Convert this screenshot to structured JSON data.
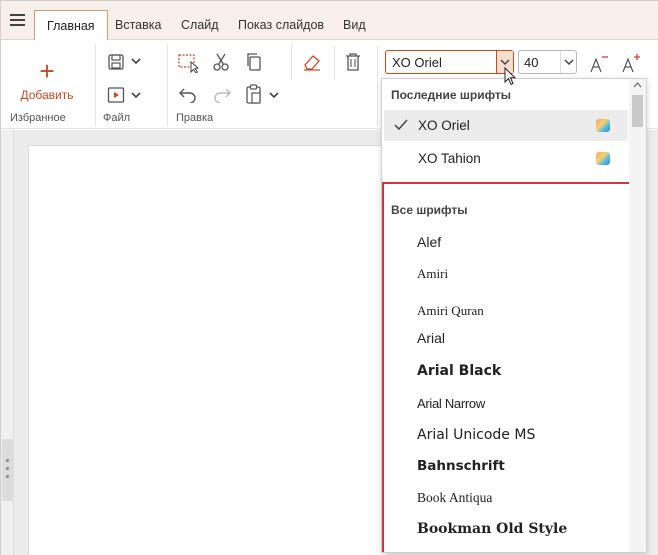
{
  "tabs": [
    "Главная",
    "Вставка",
    "Слайд",
    "Показ слайдов",
    "Вид"
  ],
  "ribbon": {
    "add_label": "Добавить",
    "groups": {
      "favorites": "Избранное",
      "file": "Файл",
      "edit": "Правка"
    },
    "font_name": "XO Oriel",
    "font_size": "40"
  },
  "dropdown": {
    "recent_header": "Последние шрифты",
    "recent": [
      "XO Oriel",
      "XO Tahion"
    ],
    "all_header": "Все шрифты",
    "fonts": [
      "Alef",
      "Amiri",
      "Amiri Quran",
      "Arial",
      "Arial Black",
      "Arial Narrow",
      "Arial Unicode MS",
      "Bahnschrift",
      "Book Antiqua",
      "Bookman Old Style"
    ]
  },
  "colors": {
    "accent": "#c8481f",
    "highlight_border": "#d6323a"
  }
}
